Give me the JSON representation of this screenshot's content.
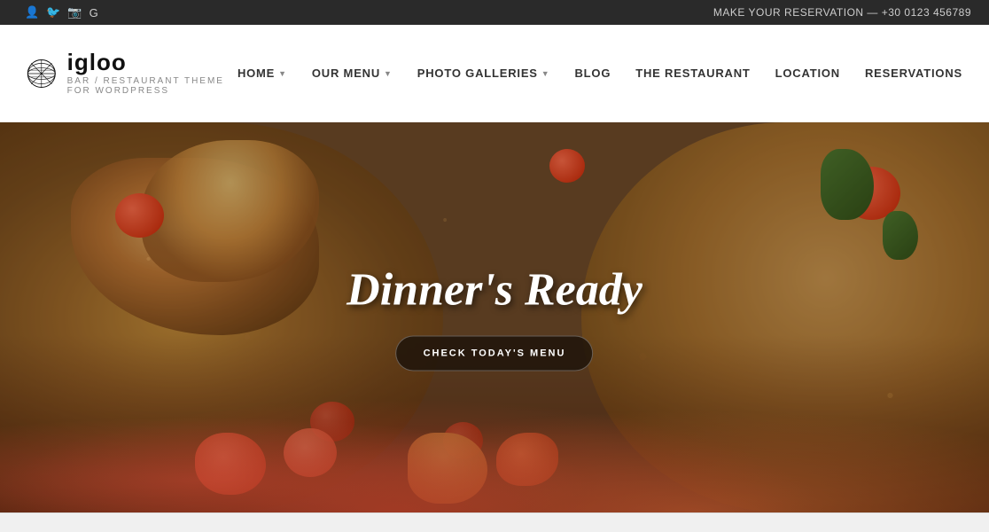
{
  "topbar": {
    "phone_label": "MAKE YOUR RESERVATION — +30 0123 456789",
    "social_icons": [
      "f",
      "t",
      "ig",
      "g+"
    ]
  },
  "header": {
    "logo_name": "igloo",
    "logo_tagline": "BAR / RESTAURANT THEME FOR WORDPRESS",
    "logo_icon_alt": "igloo-logo"
  },
  "nav": {
    "items": [
      {
        "label": "HOME",
        "has_dropdown": true
      },
      {
        "label": "OUR MENU",
        "has_dropdown": true
      },
      {
        "label": "PHOTO GALLERIES",
        "has_dropdown": true
      },
      {
        "label": "BLOG",
        "has_dropdown": false
      },
      {
        "label": "THE RESTAURANT",
        "has_dropdown": false
      },
      {
        "label": "LOCATION",
        "has_dropdown": false
      },
      {
        "label": "RESERVATIONS",
        "has_dropdown": false
      }
    ]
  },
  "hero": {
    "title": "Dinner's Ready",
    "button_label": "CHECK TODAY'S MENU"
  }
}
